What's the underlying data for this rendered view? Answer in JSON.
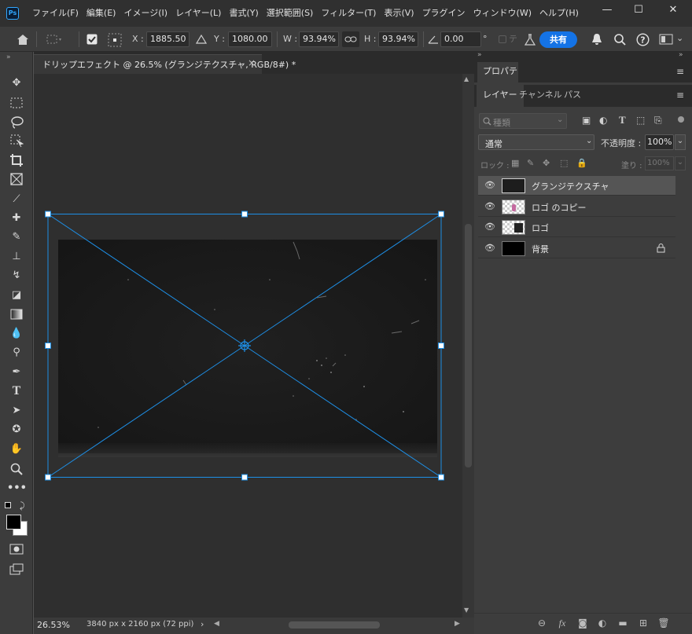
{
  "app": {
    "logo_text": "Ps",
    "menu": [
      "ファイル(F)",
      "編集(E)",
      "イメージ(I)",
      "レイヤー(L)",
      "書式(Y)",
      "選択範囲(S)",
      "フィルター(T)",
      "表示(V)",
      "プラグイン",
      "ウィンドウ(W)",
      "ヘルプ(H)"
    ],
    "window_controls": {
      "minimize": "—",
      "maximize": "☐",
      "close": "✕"
    }
  },
  "options": {
    "x_label": "X :",
    "x_value": "1885.50 px",
    "y_label": "Y :",
    "y_value": "1080.00 px",
    "w_label": "W :",
    "w_value": "93.94%",
    "h_label": "H :",
    "h_value": "93.94%",
    "angle_value": "0.00",
    "degree_sign": "°",
    "share_label": "共有"
  },
  "document": {
    "tab_title": "ドリップエフェクト @ 26.5% (グランジテクスチャ, RGB/8#) *",
    "close_glyph": "×",
    "zoom": "26.53%",
    "info": "3840 px x 2160 px (72 ppi)",
    "info_arrow": "›"
  },
  "panels": {
    "properties_tab": "プロパティ",
    "layer_tabs": [
      "レイヤー",
      "チャンネル",
      "パス"
    ],
    "filter_placeholder": "種類",
    "blend_mode": "通常",
    "opacity_label": "不透明度 :",
    "opacity_value": "100%",
    "lock_label": "ロック :",
    "fill_label": "塗り :",
    "fill_value": "100%",
    "layers": [
      {
        "name": "グランジテクスチャ",
        "selected": true,
        "thumb": "dark"
      },
      {
        "name": "ロゴ のコピー",
        "selected": false,
        "thumb": "checker-pink"
      },
      {
        "name": "ロゴ",
        "selected": false,
        "thumb": "checker-logo"
      },
      {
        "name": "背景",
        "selected": false,
        "thumb": "black",
        "locked": true
      }
    ]
  }
}
